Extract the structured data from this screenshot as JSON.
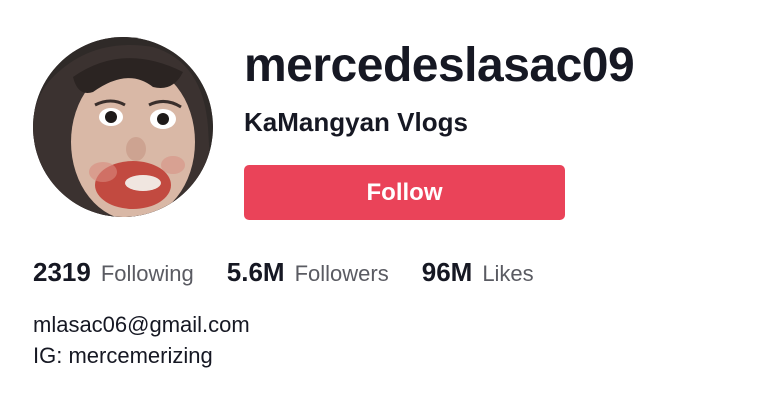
{
  "profile": {
    "username": "mercedeslasac09",
    "display_name": "KaMangyan Vlogs",
    "avatar_icon": "profile-photo-avatar"
  },
  "actions": {
    "follow_label": "Follow",
    "follow_color": "#ea4359"
  },
  "stats": [
    {
      "value": "2319",
      "label": "Following"
    },
    {
      "value": "5.6M",
      "label": "Followers"
    },
    {
      "value": "96M",
      "label": "Likes"
    }
  ],
  "bio": {
    "lines": [
      "mlasac06@gmail.com",
      "IG: mercemerizing"
    ]
  }
}
